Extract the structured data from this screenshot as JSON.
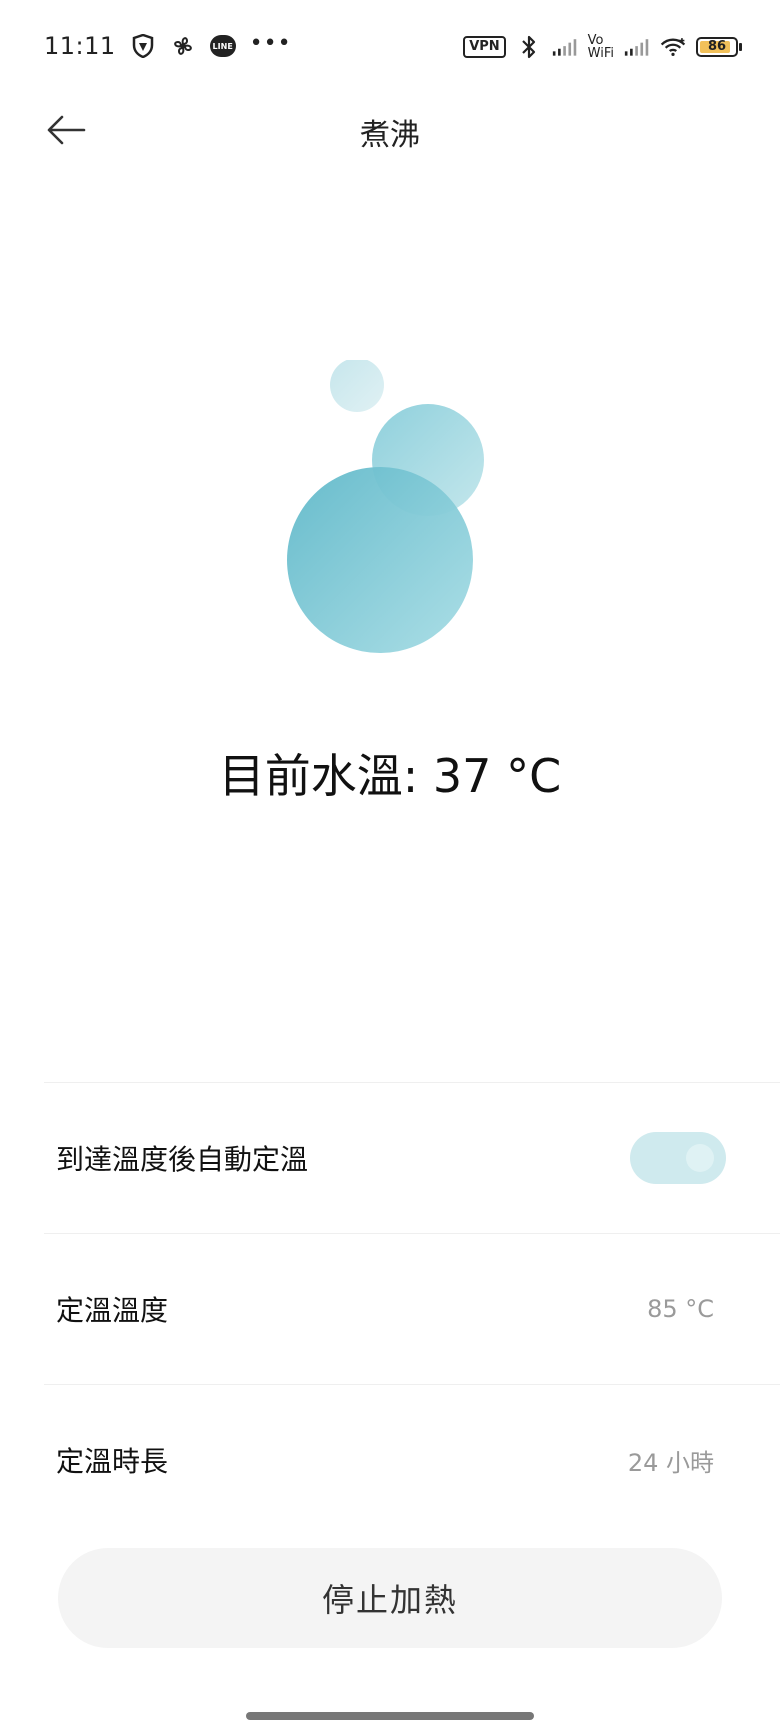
{
  "status_bar": {
    "time": "11:11",
    "line_label": "LINE",
    "more": "•••",
    "vpn": "VPN",
    "vowifi_top": "Vo",
    "vowifi_bottom": "WiFi",
    "battery": "86"
  },
  "header": {
    "title": "煮沸"
  },
  "main": {
    "current_temp": "目前水溫: 37 °C"
  },
  "settings": {
    "auto_keep_warm": {
      "label": "到達溫度後自動定溫",
      "enabled": true
    },
    "keep_warm_temp": {
      "label": "定溫溫度",
      "value": "85 °C"
    },
    "keep_warm_duration": {
      "label": "定溫時長",
      "value": "24 小時"
    }
  },
  "actions": {
    "stop_label": "停止加熱"
  },
  "colors": {
    "bubble": "#5fb8c9",
    "bubble_light": "#a8dbe3",
    "toggle_track": "#cfeaee",
    "button_bg": "#f4f4f4"
  }
}
